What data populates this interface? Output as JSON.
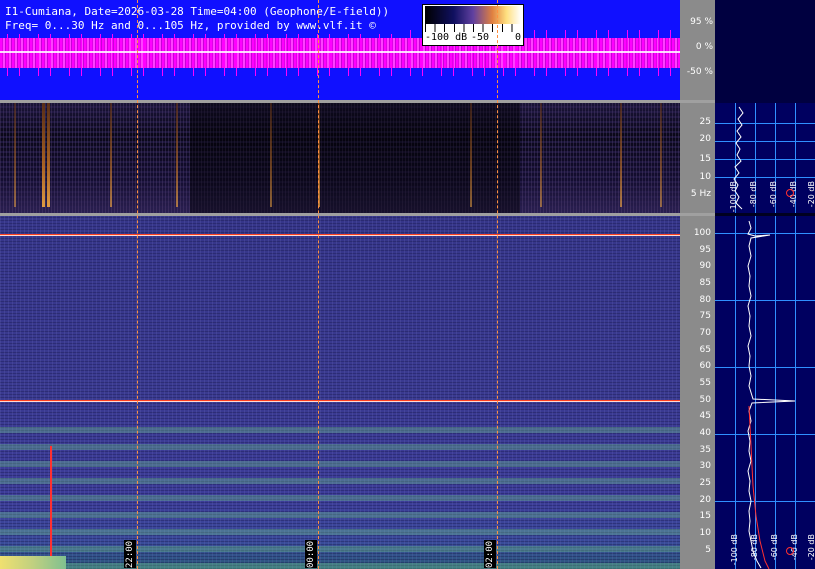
{
  "header": {
    "line1": "I1-Cumiana, Date=2026-03-28 Time=04:00 (Geophone/E-field))",
    "line2": "Freq= 0...30 Hz and 0...105 Hz, provided by www.vlf.it ©"
  },
  "colorbar": {
    "labels": [
      "-100 dB",
      "-50",
      "0"
    ]
  },
  "amplitude_scale": [
    "95 %",
    "0 %",
    "-50 %"
  ],
  "low_freq_scale": [
    "25",
    "20",
    "15",
    "10",
    "5 Hz"
  ],
  "main_freq_scale": [
    "100",
    "95",
    "90",
    "85",
    "80",
    "75",
    "70",
    "65",
    "60",
    "55",
    "50",
    "45",
    "40",
    "35",
    "30",
    "25",
    "20",
    "15",
    "10",
    "5"
  ],
  "time_labels": [
    "22:00",
    "00:00",
    "02:00"
  ],
  "db_labels_low": [
    "-100 dB",
    "-80 dB",
    "-60 dB",
    "-40 dB",
    "-20 dB"
  ],
  "db_labels_main": [
    "-100 dB",
    "-80 dB",
    "-60 dB",
    "-40 dB",
    "-20 dB"
  ],
  "colors": {
    "waveform": "#ff00ff",
    "waveform_bg": "#1010ff",
    "mains_line": "#ff4020",
    "grid": "#3090ff"
  }
}
